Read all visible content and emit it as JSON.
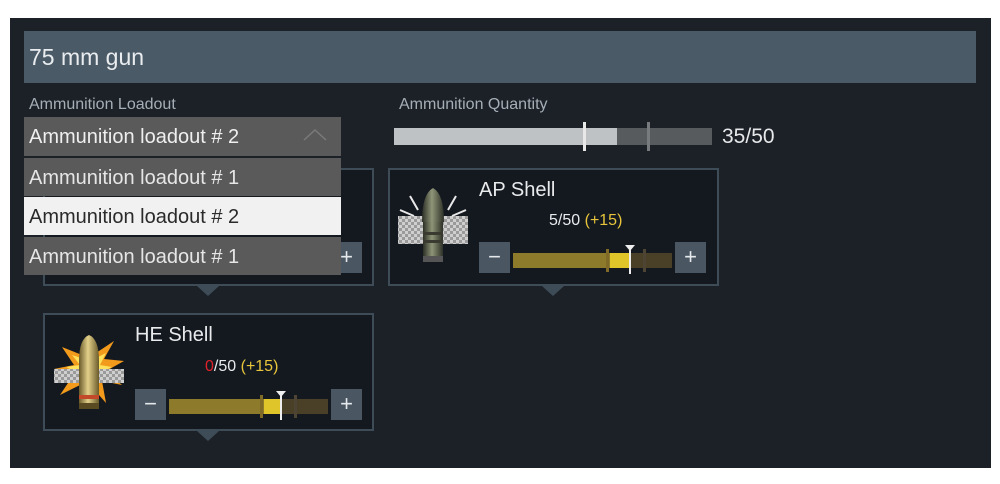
{
  "window": {
    "title": "75 mm gun"
  },
  "loadout": {
    "label": "Ammunition Loadout",
    "selected": "Ammunition loadout # 2",
    "options": [
      "Ammunition loadout # 1",
      "Ammunition loadout # 2",
      "Ammunition loadout # 1"
    ],
    "highlighted_index": 1
  },
  "quantity": {
    "label": "Ammunition Quantity",
    "text": "35/50",
    "fill_fraction": 0.7
  },
  "ammo": [
    {
      "name": "AP Shell",
      "current": "5",
      "max": "/50",
      "bonus": "(+15)",
      "current_color": "#e8eaec",
      "minus_label": "−",
      "plus_label": "+",
      "fill_fraction": 0.61,
      "bonus_fraction": 0.73,
      "icon": "ap-shell-icon"
    },
    {
      "name": "HE Shell",
      "current": "0",
      "max": "/50",
      "bonus": "(+15)",
      "current_color": "#e0222a",
      "minus_label": "−",
      "plus_label": "+",
      "fill_fraction": 0.6,
      "bonus_fraction": 0.7,
      "icon": "he-shell-icon"
    }
  ],
  "hidden_card": {
    "plus_label": "+"
  }
}
